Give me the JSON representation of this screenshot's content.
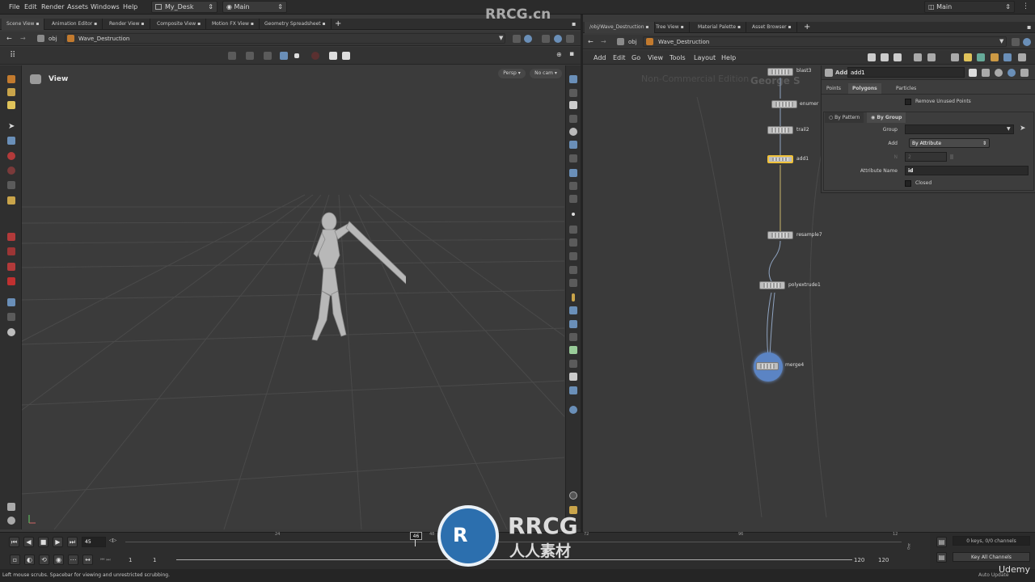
{
  "menubar": {
    "items": [
      "File",
      "Edit",
      "Render",
      "Assets",
      "Windows",
      "Help"
    ],
    "desktop": "My_Desk",
    "context": "Main",
    "right_context": "Main"
  },
  "left_pane": {
    "tabs": [
      "Scene View",
      "Animation Editor",
      "Render View",
      "Composite View",
      "Motion FX View",
      "Geometry Spreadsheet"
    ],
    "path_root": "obj",
    "path_node": "Wave_Destruction",
    "viewport_label": "View",
    "persp": "Persp",
    "cam": "No cam"
  },
  "right_pane": {
    "tabs": [
      "/obj/Wave_Destruction",
      "Tree View",
      "Material Palette",
      "Asset Browser"
    ],
    "path_root": "obj",
    "path_node": "Wave_Destruction",
    "menu": [
      "Add",
      "Edit",
      "Go",
      "View",
      "Tools",
      "Layout",
      "Help"
    ],
    "edition": "Non-Commercial Edition",
    "overlay_text": "George S"
  },
  "network": {
    "nodes": [
      {
        "name": "blast3",
        "label": "blast3"
      },
      {
        "name": "enumerate",
        "label": "enumer"
      },
      {
        "name": "trail2",
        "label": "trail2"
      },
      {
        "name": "add1",
        "label": "add1"
      },
      {
        "name": "resample7",
        "label": "resample7"
      },
      {
        "name": "polyextrude1",
        "label": "polyextrude1"
      },
      {
        "name": "merge4",
        "label": "merge4"
      }
    ]
  },
  "params": {
    "node_type": "Add",
    "node_name": "add1",
    "tabs": [
      "Points",
      "Polygons",
      "Particles"
    ],
    "active_tab": "Polygons",
    "remove_unused": "Remove Unused Points",
    "subtabs": [
      "By Pattern",
      "By Group"
    ],
    "group_label": "Group",
    "add_label": "Add",
    "add_value": "By Attribute",
    "n_label": "N",
    "n_value": "2",
    "attr_label": "Attribute Name",
    "attr_value": "id",
    "closed_label": "Closed"
  },
  "timeline": {
    "current_frame": "45",
    "marker_frame": "46",
    "start": "1",
    "start2": "1",
    "end": "120",
    "end2": "120",
    "ticks": [
      "24",
      "48",
      "72",
      "96",
      "12"
    ],
    "keys_status": "0 keys, 0/0 channels",
    "key_all": "Key All Channels",
    "auto_update": "Auto Update"
  },
  "status": {
    "text": "Left mouse scrubs. Spacebar for viewing and unrestricted scrubbing."
  },
  "watermarks": {
    "top": "RRCG.cn",
    "logo_en": "RRCG",
    "logo_cn": "人人素材",
    "udemy": "Udemy"
  },
  "colors": {
    "accent_blue": "#5b84c4",
    "node_selected": "#f0c23a"
  }
}
